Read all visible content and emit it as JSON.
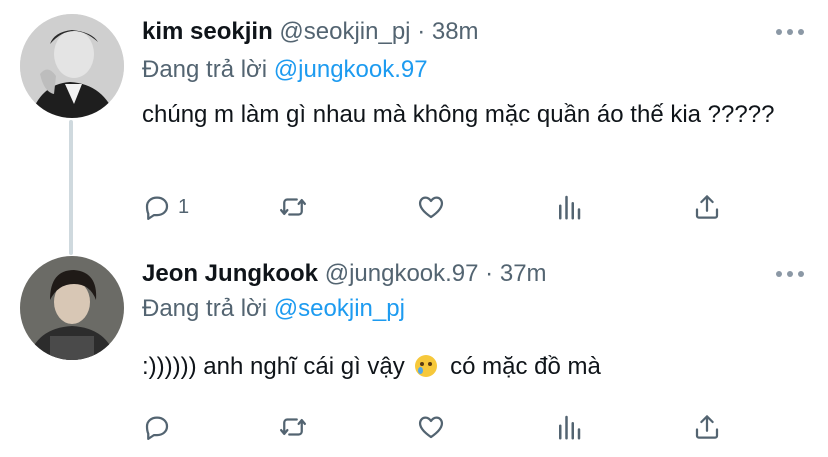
{
  "colors": {
    "accent": "#1d9bf0",
    "secondary_text": "#536471",
    "icon": "#536471",
    "thread_line": "#cfd9de"
  },
  "tweets": [
    {
      "name": "kim seokjin",
      "handle": "@seokjin_pj",
      "dot": "·",
      "time": "38m",
      "reply_prefix": "Đang trả lời",
      "reply_to": "@jungkook.97",
      "text": "chúng m làm gì nhau mà không mặc quần áo thế kia ?????",
      "reply_count": "1",
      "icons": [
        "reply-icon",
        "retweet-icon",
        "like-icon",
        "views-icon",
        "share-icon"
      ]
    },
    {
      "name": "Jeon Jungkook",
      "handle": "@jungkook.97",
      "dot": "·",
      "time": "37m",
      "reply_prefix": "Đang trả lời",
      "reply_to": "@seokjin_pj",
      "text_before": ":)))))) anh nghĩ cái gì vậy",
      "emoji_icon": "crying-face-emoji",
      "text_after": " có mặc đồ mà",
      "reply_count": "",
      "icons": [
        "reply-icon",
        "retweet-icon",
        "like-icon",
        "views-icon",
        "share-icon"
      ]
    }
  ]
}
